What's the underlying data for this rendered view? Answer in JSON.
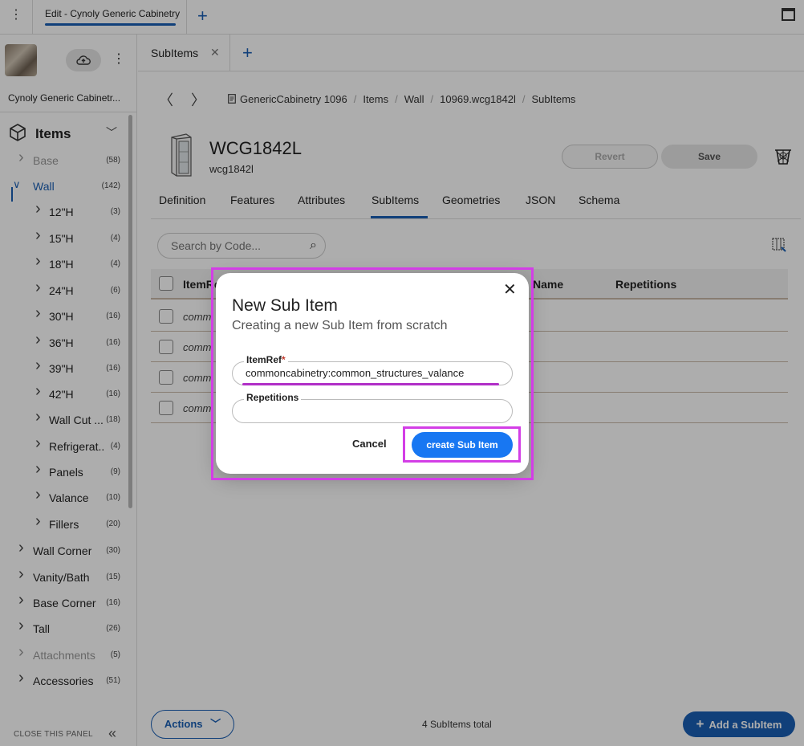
{
  "topbar": {
    "doc_tab_label": "Edit - Cynoly Generic Cabinetry",
    "new_tab_symbol": "+"
  },
  "sidebar": {
    "project_name": "Cynoly Generic Cabinetr...",
    "items_title": "Items",
    "tree": [
      {
        "label": "Base",
        "count": "(58)",
        "dim": true
      },
      {
        "label": "Wall",
        "count": "(142)",
        "expanded": true
      },
      {
        "label": "12\"H",
        "count": "(3)"
      },
      {
        "label": "15\"H",
        "count": "(4)"
      },
      {
        "label": "18\"H",
        "count": "(4)"
      },
      {
        "label": "24\"H",
        "count": "(6)"
      },
      {
        "label": "30\"H",
        "count": "(16)"
      },
      {
        "label": "36\"H",
        "count": "(16)"
      },
      {
        "label": "39\"H",
        "count": "(16)"
      },
      {
        "label": "42\"H",
        "count": "(16)"
      },
      {
        "label": "Wall Cut ...",
        "count": "(18)"
      },
      {
        "label": "Refrigerat...",
        "count": "(4)"
      },
      {
        "label": "Panels",
        "count": "(9)"
      },
      {
        "label": "Valance",
        "count": "(10)"
      },
      {
        "label": "Fillers",
        "count": "(20)"
      },
      {
        "label": "Wall Corner",
        "count": "(30)"
      },
      {
        "label": "Vanity/Bath",
        "count": "(15)"
      },
      {
        "label": "Base Corner",
        "count": "(16)"
      },
      {
        "label": "Tall",
        "count": "(26)"
      },
      {
        "label": "Attachments",
        "count": "(5)",
        "dim": true
      },
      {
        "label": "Accessories",
        "count": "(51)"
      }
    ],
    "close_panel_label": "CLOSE THIS PANEL"
  },
  "main": {
    "subtab_label": "SubItems",
    "breadcrumb": [
      "GenericCabinetry 1096",
      "Items",
      "Wall",
      "10969.wcg1842l",
      "SubItems"
    ],
    "item_title": "WCG1842L",
    "item_code": "wcg1842l",
    "revert_label": "Revert",
    "save_label": "Save",
    "tabs": [
      "Definition",
      "Features",
      "Attributes",
      "SubItems",
      "Geometries",
      "JSON",
      "Schema"
    ],
    "active_tab": "SubItems",
    "search_placeholder": "Search by Code...",
    "table": {
      "headers": [
        "ItemRef",
        "Name",
        "Repetitions"
      ],
      "rows": [
        "comm",
        "comm",
        "comm",
        "comm"
      ]
    },
    "actions_label": "Actions",
    "total_label": "4 SubItems total",
    "add_subitem_label": "Add a SubItem"
  },
  "dialog": {
    "title": "New Sub Item",
    "subtitle": "Creating a new Sub Item from scratch",
    "itemref_label": "ItemRef",
    "itemref_required": "*",
    "itemref_value": "commoncabinetry:common_structures_valance",
    "repetitions_label": "Repetitions",
    "repetitions_value": "",
    "cancel_label": "Cancel",
    "create_label": "create Sub Item"
  },
  "colors": {
    "accent": "#1a5fb4",
    "create_button": "#1877f2",
    "highlight": "#d33ee6"
  }
}
